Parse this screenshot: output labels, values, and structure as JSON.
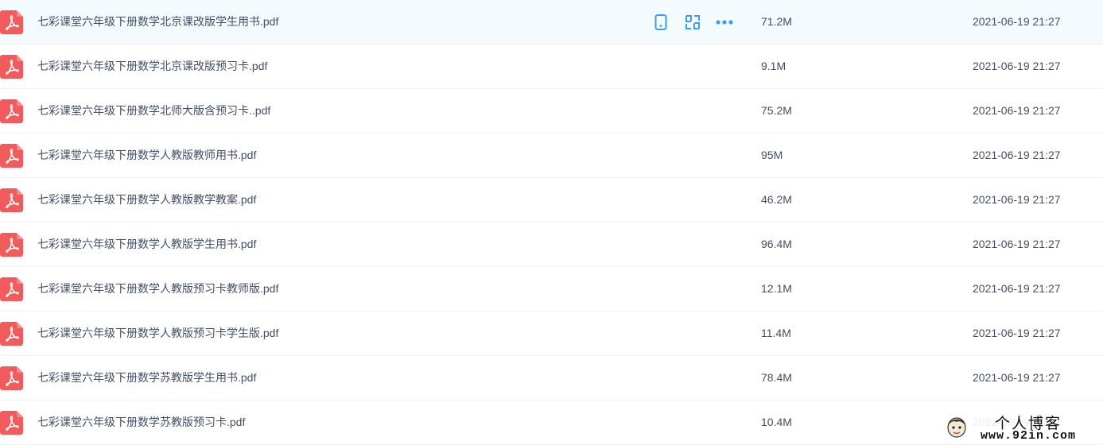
{
  "files": [
    {
      "name": "七彩课堂六年级下册数学北京课改版学生用书.pdf",
      "size": "71.2M",
      "modified": "2021-06-19 21:27",
      "hovered": true
    },
    {
      "name": "七彩课堂六年级下册数学北京课改版预习卡.pdf",
      "size": "9.1M",
      "modified": "2021-06-19 21:27"
    },
    {
      "name": "七彩课堂六年级下册数学北师大版含预习卡..pdf",
      "size": "75.2M",
      "modified": "2021-06-19 21:27"
    },
    {
      "name": "七彩课堂六年级下册数学人教版教师用书.pdf",
      "size": "95M",
      "modified": "2021-06-19 21:27"
    },
    {
      "name": "七彩课堂六年级下册数学人教版教学教案.pdf",
      "size": "46.2M",
      "modified": "2021-06-19 21:27"
    },
    {
      "name": "七彩课堂六年级下册数学人教版学生用书.pdf",
      "size": "96.4M",
      "modified": "2021-06-19 21:27"
    },
    {
      "name": "七彩课堂六年级下册数学人教版预习卡教师版.pdf",
      "size": "12.1M",
      "modified": "2021-06-19 21:27"
    },
    {
      "name": "七彩课堂六年级下册数学人教版预习卡学生版.pdf",
      "size": "11.4M",
      "modified": "2021-06-19 21:27"
    },
    {
      "name": "七彩课堂六年级下册数学苏教版学生用书.pdf",
      "size": "78.4M",
      "modified": "2021-06-19 21:27"
    },
    {
      "name": "七彩课堂六年级下册数学苏教版预习卡.pdf",
      "size": "10.4M",
      "modified": "2021-06-19 21:27"
    }
  ],
  "row_actions": [
    {
      "icon": "phone-icon"
    },
    {
      "icon": "share-icon"
    },
    {
      "icon": "more-icon"
    }
  ],
  "watermark": {
    "title": "个人博客",
    "url": "www.92in.com"
  },
  "colors": {
    "pdf_red": "#f25b5b",
    "action_blue": "#3b9cf0",
    "text": "#424e67",
    "hover_bg": "#f4fbff"
  }
}
